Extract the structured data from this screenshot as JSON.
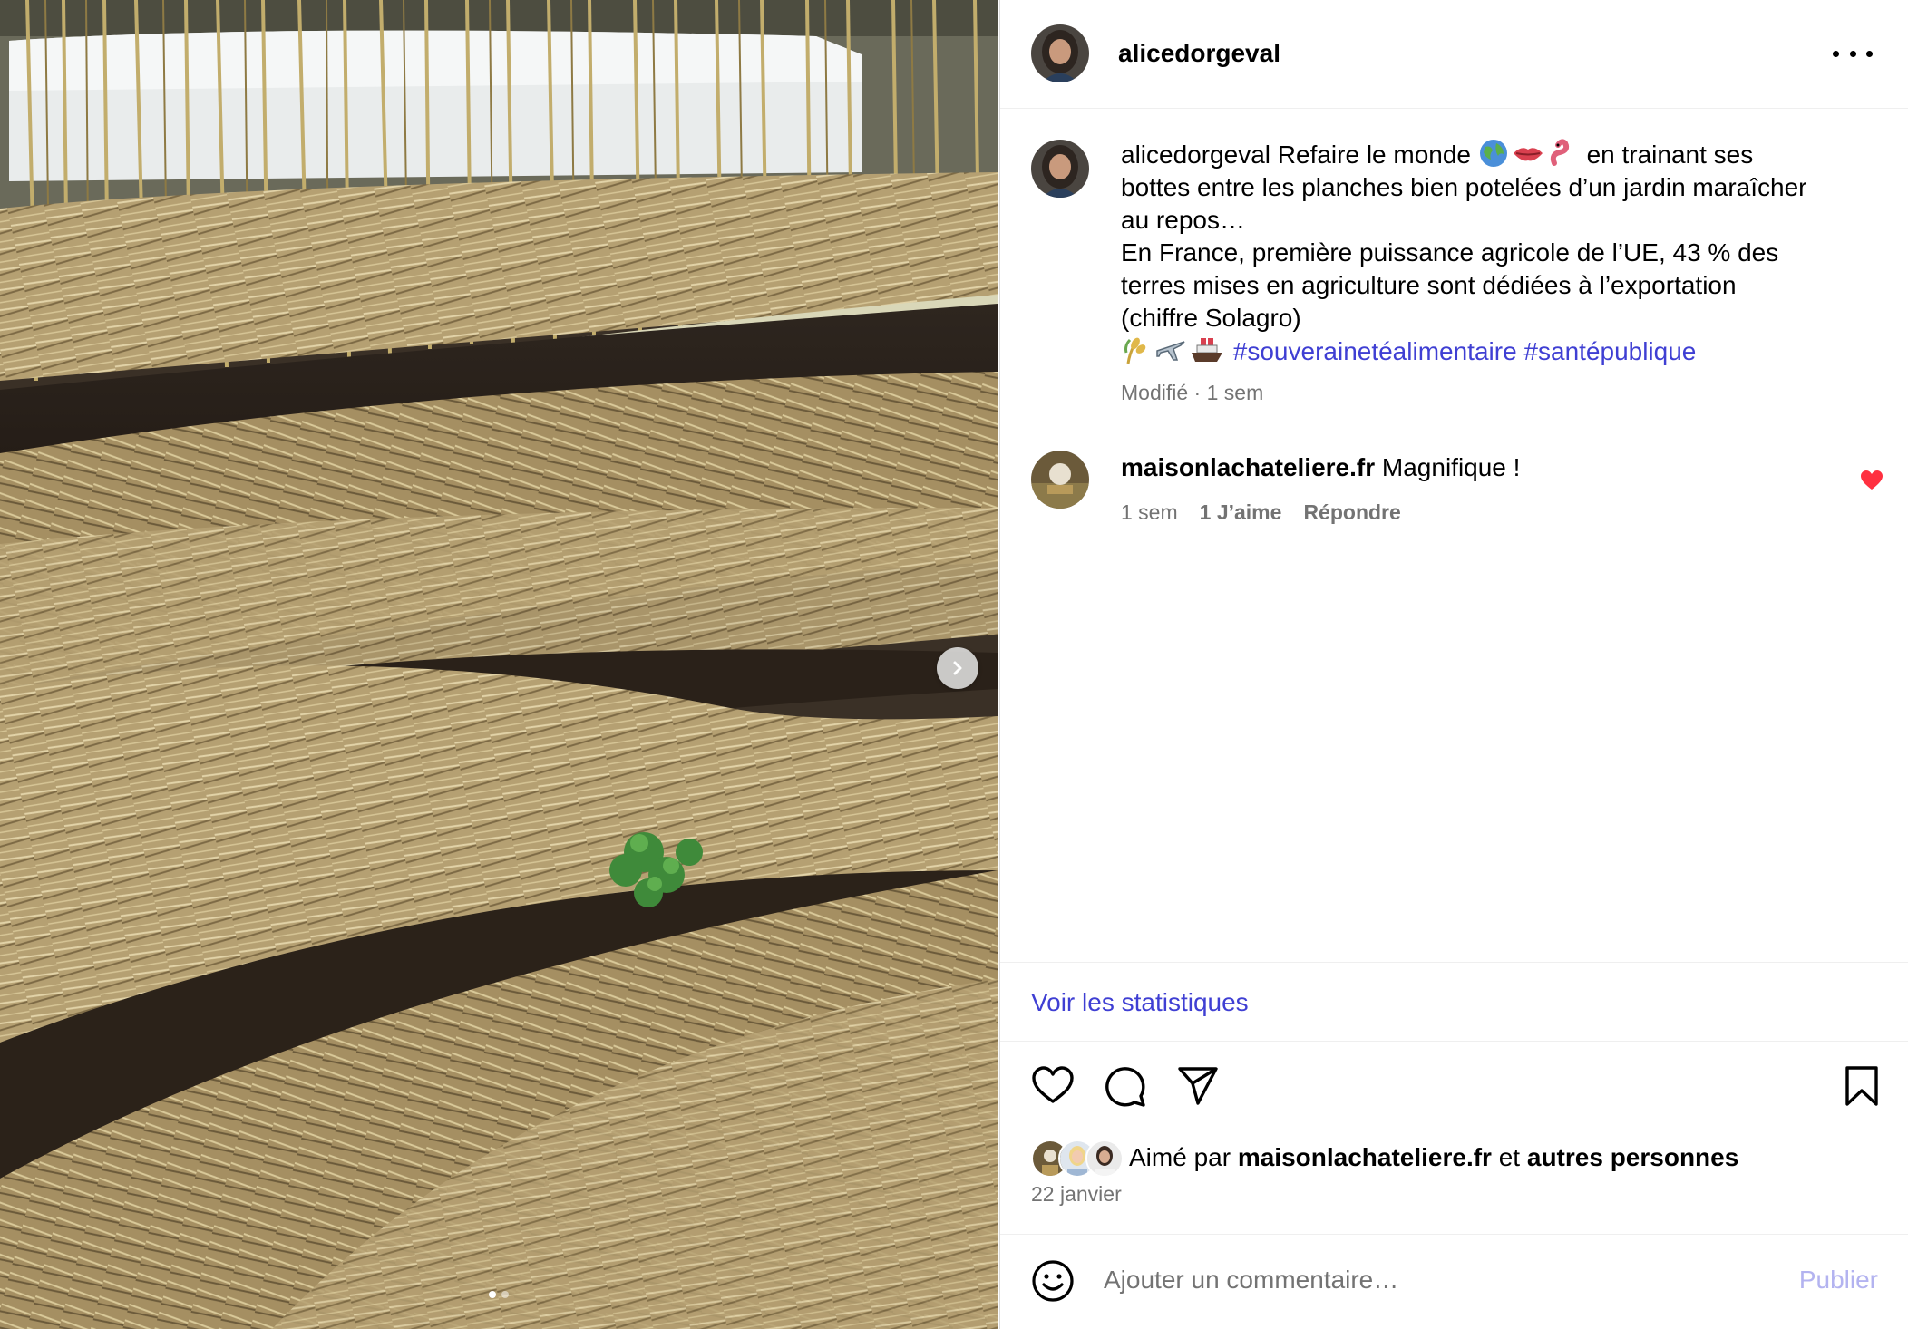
{
  "post": {
    "username": "alicedorgeval",
    "caption_lines": [
      " Refaire le monde ",
      " en trainant ses",
      "bottes entre les planches bien potelées d’un jardin maraîcher",
      "au repos…",
      "En France, première puissance agricole de l’UE, 43 % des",
      "terres mises en agriculture sont dédiées à l’exportation",
      "(chiffre Solagro)"
    ],
    "hashtags": [
      "#souverainetéalimentaire",
      "#santépublique"
    ],
    "caption_emojis": [
      "globe-icon",
      "lips-icon",
      "worm-icon"
    ],
    "hashtag_emojis": [
      "wheat-icon",
      "airplane-icon",
      "ship-icon"
    ],
    "edited": "Modifié",
    "age": "1 sem",
    "image_alt": "",
    "carousel": {
      "count": 2,
      "active": 1
    }
  },
  "comment": {
    "username": "maisonlachateliere.fr",
    "text": " Magnifique !",
    "age": "1 sem",
    "likes": "1 J’aime",
    "reply": "Répondre",
    "liked": true
  },
  "stats_link": "Voir les statistiques",
  "likes_summary": {
    "prefix": "Aimé par ",
    "user": "maisonlachateliere.fr",
    "middle": " et ",
    "others": "autres personnes"
  },
  "date": "22 janvier",
  "add_comment": {
    "placeholder": "Ajouter un commentaire…",
    "publish": "Publier"
  },
  "colors": {
    "link": "#3f3fd3",
    "muted": "#737373",
    "heart": "#ff3040",
    "publish_disabled": "#b3b3f0"
  }
}
